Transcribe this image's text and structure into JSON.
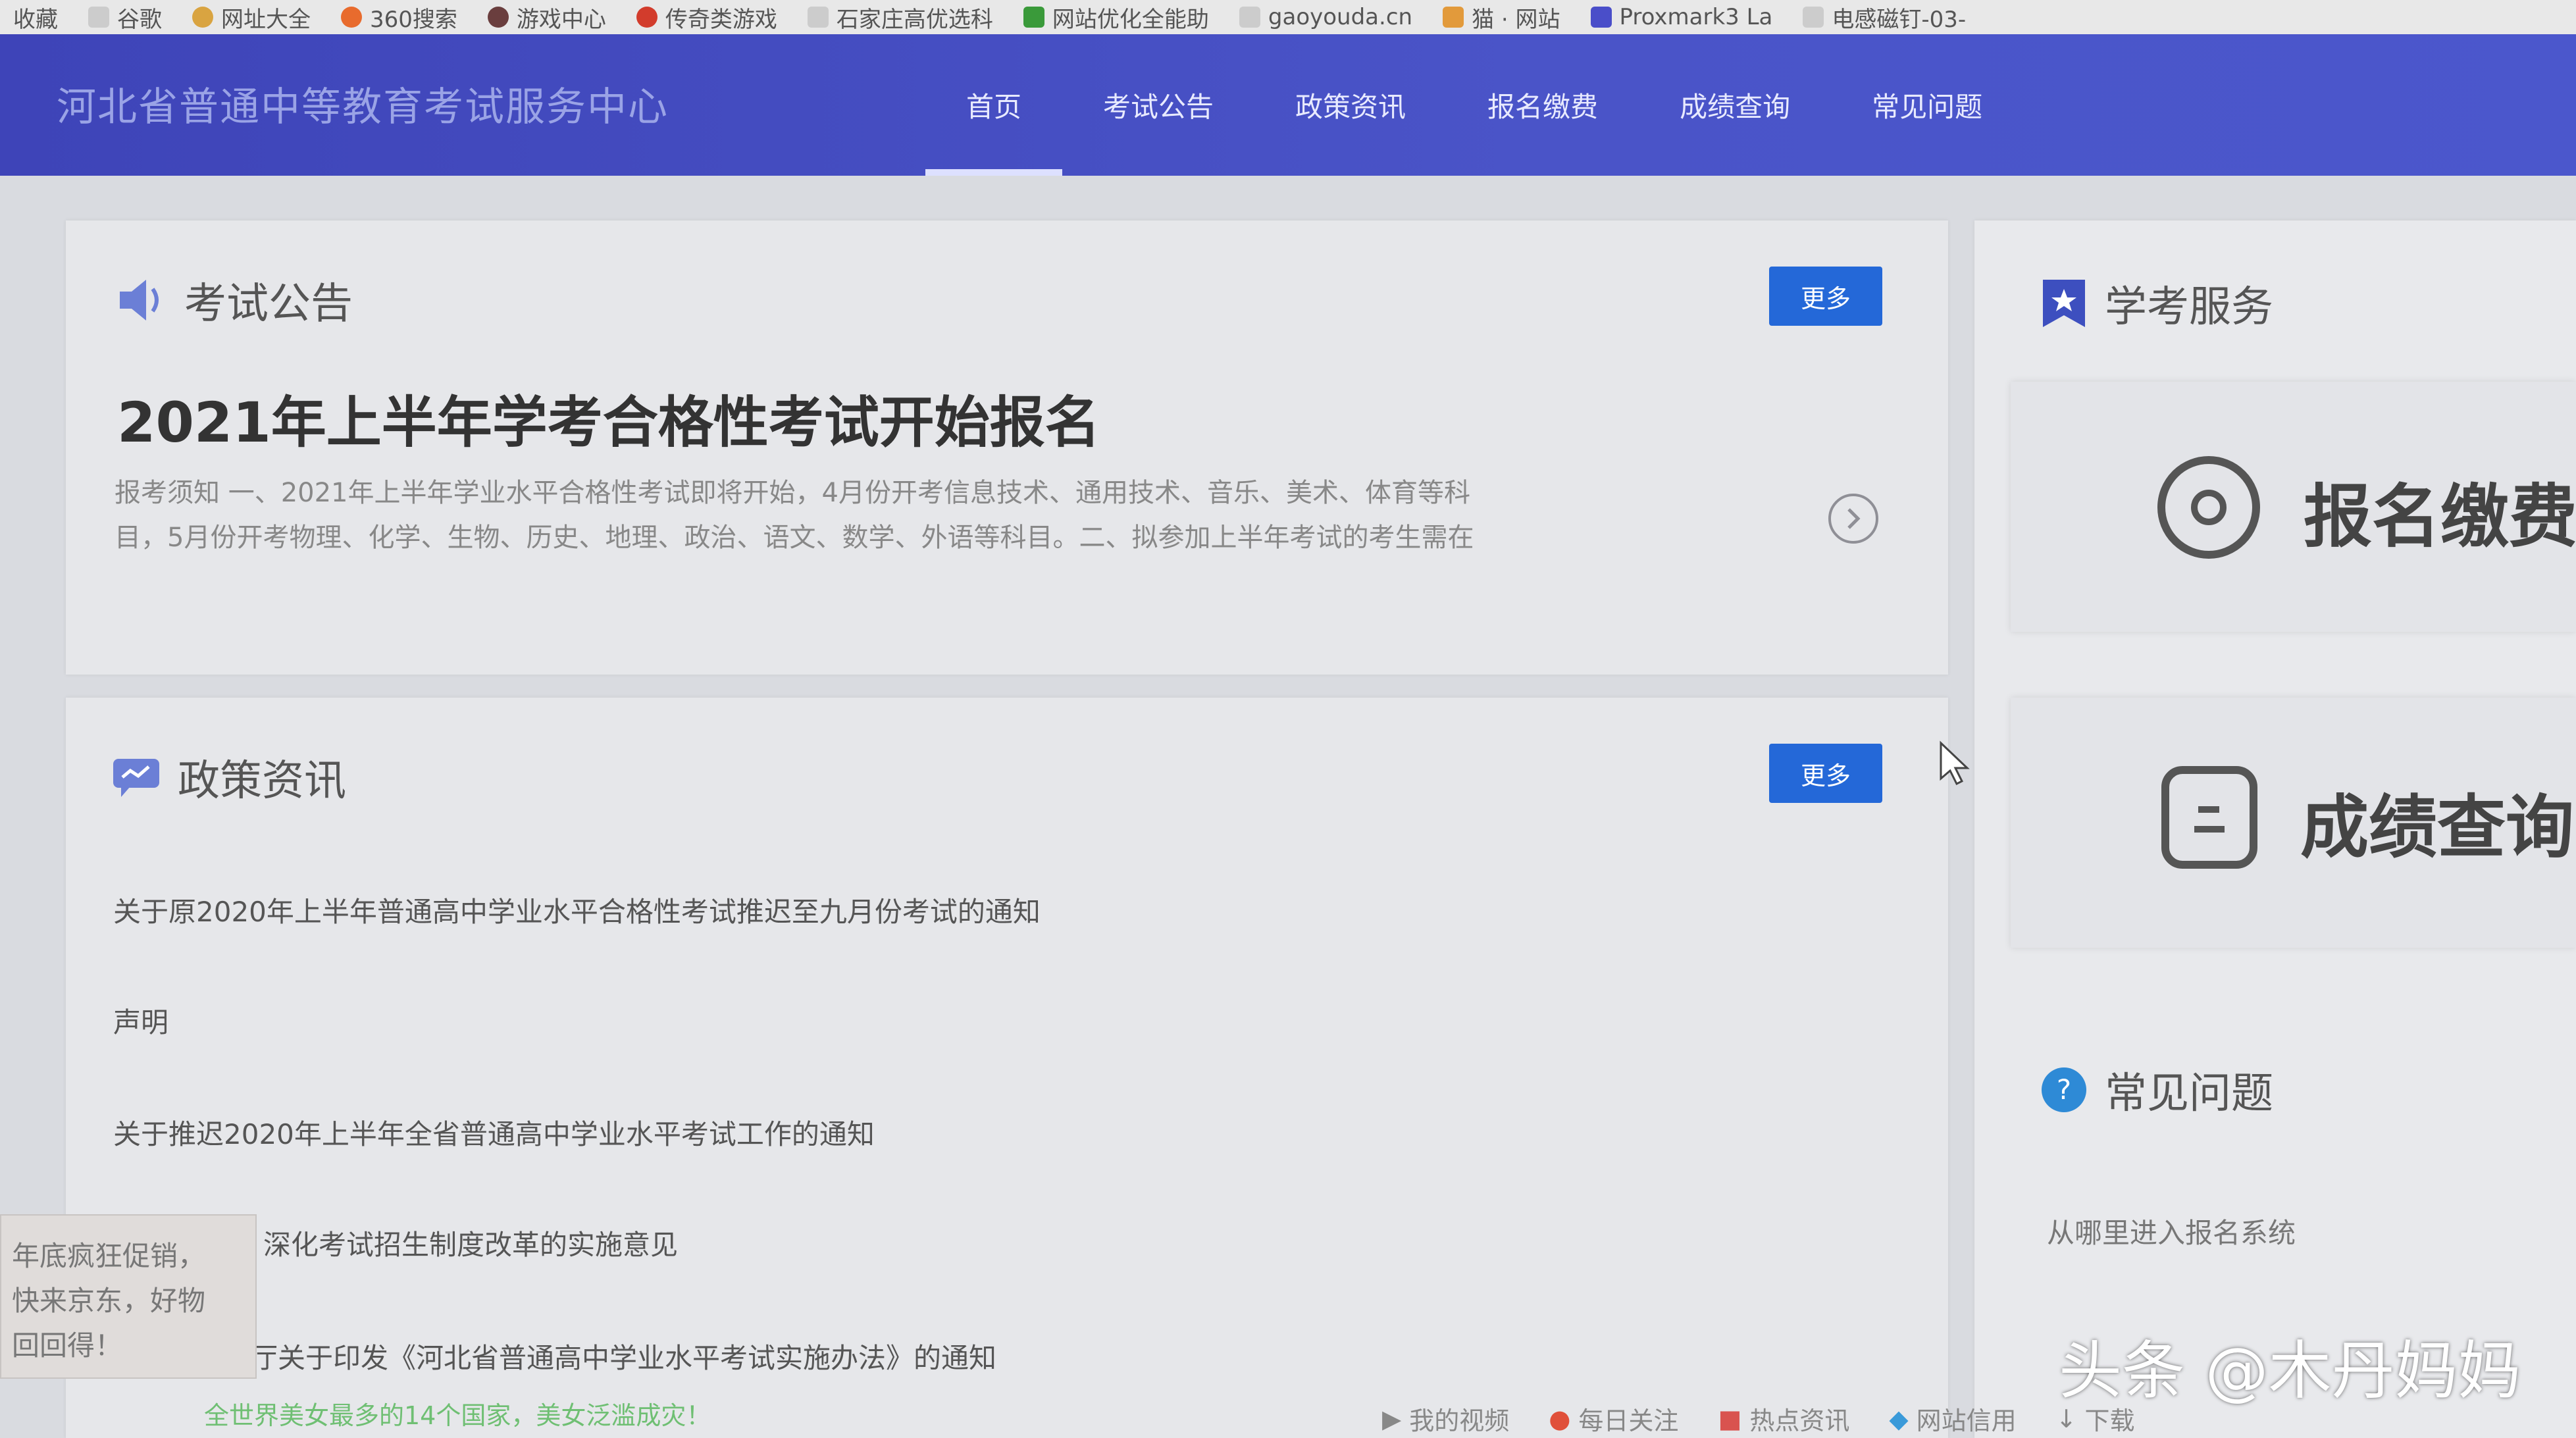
{
  "bookmarks": [
    "收藏",
    "谷歌",
    "网址大全",
    "360搜索",
    "游戏中心",
    "传奇类游戏",
    "石家庄高优选科",
    "网站优化全能助",
    "gaoyouda.cn",
    "猫 · 网站",
    "Proxmark3 La",
    "电感磁钉-03-"
  ],
  "header": {
    "site_title": "河北省普通中等教育考试服务中心",
    "nav": [
      "首页",
      "考试公告",
      "政策资讯",
      "报名缴费",
      "成绩查询",
      "常见问题"
    ]
  },
  "announcement": {
    "title": "考试公告",
    "more": "更多",
    "headline": "2021年上半年学考合格性考试开始报名",
    "summary_line1": "报考须知 一、2021年上半年学业水平合格性考试即将开始，4月份开考信息技术、通用技术、音乐、美术、体育等科",
    "summary_line2": "目，5月份开考物理、化学、生物、历史、地理、政治、语文、数学、外语等科目。二、拟参加上半年考试的考生需在"
  },
  "policy": {
    "title": "政策资讯",
    "more": "更多",
    "items": [
      "关于原2020年上半年普通高中学业水平合格性考试推迟至九月份考试的通知",
      "声明",
      "关于推迟2020年上半年全省普通高中学业水平考试工作的通知",
      "深化考试招生制度改革的实施意见",
      "厅关于印发《河北省普通高中学业水平考试实施办法》的通知"
    ]
  },
  "services": {
    "title": "学考服务",
    "register": "报名缴费",
    "scores": "成绩查询"
  },
  "faq": {
    "title": "常见问题",
    "items": [
      "从哪里进入报名系统"
    ]
  },
  "popup": {
    "line1": "年底疯狂促销，",
    "line2": "快来京东，好物",
    "line3": "回回得！"
  },
  "ad_link": "全世界美女最多的14个国家，美女泛滥成灾！",
  "taskbar": [
    "我的视频",
    "每日关注",
    "热点资讯",
    "网站信用",
    "下载"
  ],
  "watermark": "头条 @木丹妈妈"
}
